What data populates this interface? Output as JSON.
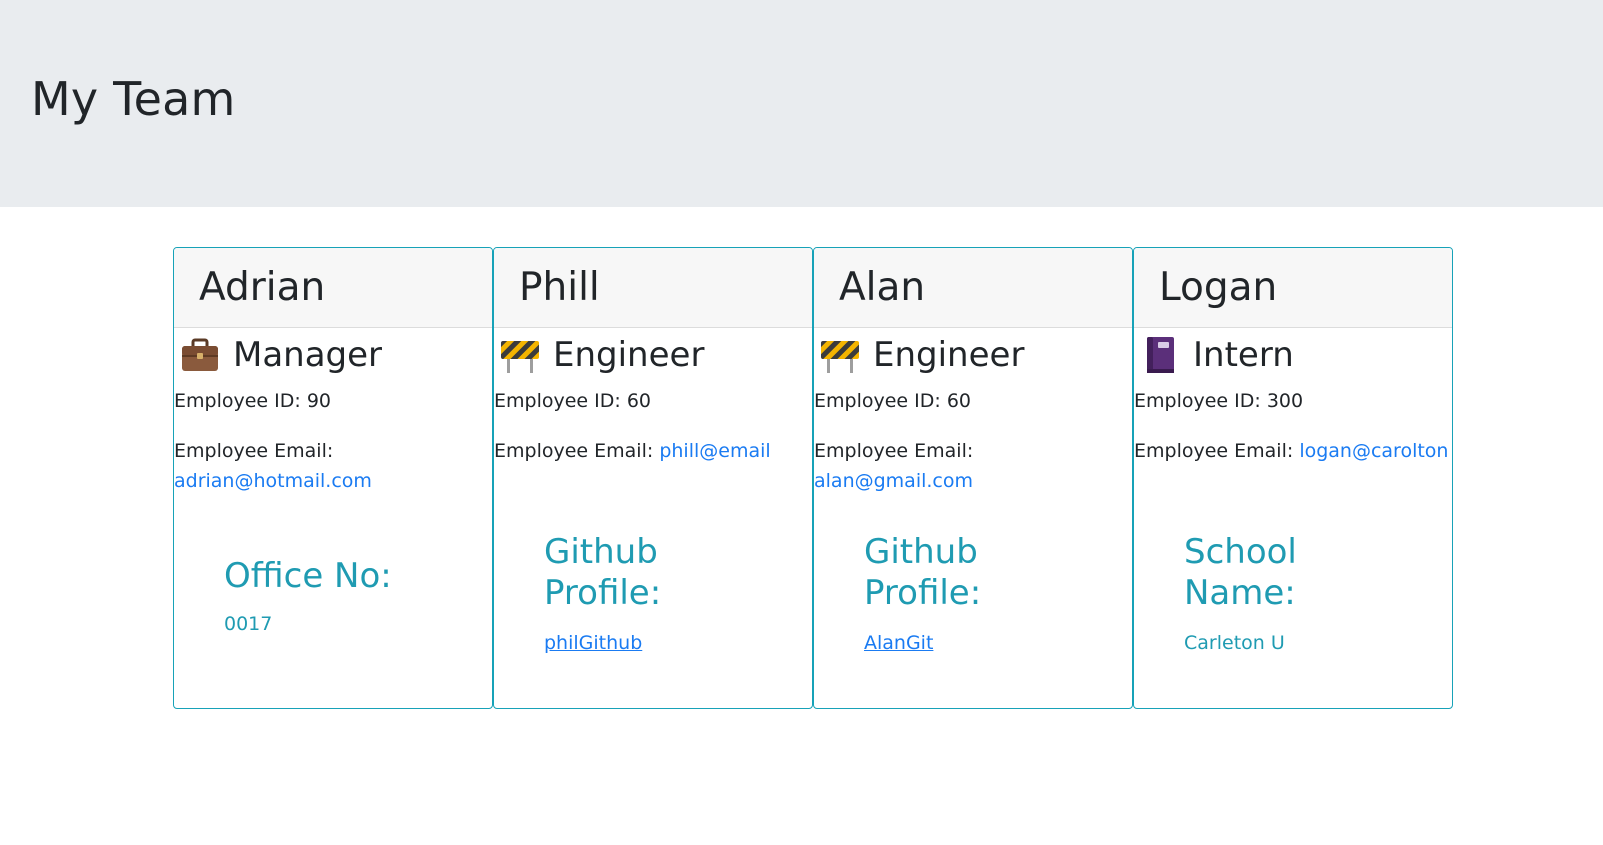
{
  "header": {
    "title": "My Team"
  },
  "employees": [
    {
      "name": "Adrian",
      "role": "Manager",
      "role_icon": "briefcase-icon",
      "id_text": "Employee ID: 90",
      "email_label": "Employee Email:",
      "email": "adrian@hotmail.com",
      "extra_label": "Office No:",
      "extra_value": "0017"
    },
    {
      "name": "Phill",
      "role": "Engineer",
      "role_icon": "construction-barrier-icon",
      "id_text": "Employee ID: 60",
      "email_label": "Employee Email:",
      "email": "phill@email",
      "extra_label": "Github Profile:",
      "extra_value": "philGithub"
    },
    {
      "name": "Alan",
      "role": "Engineer",
      "role_icon": "construction-barrier-icon",
      "id_text": "Employee ID: 60",
      "email_label": "Employee Email:",
      "email": "alan@gmail.com",
      "extra_label": "Github Profile:",
      "extra_value": "AlanGit"
    },
    {
      "name": "Logan",
      "role": "Intern",
      "role_icon": "notebook-icon",
      "id_text": "Employee ID: 300",
      "email_label": "Employee Email:",
      "email": "logan@carolton",
      "extra_label": "School Name:",
      "extra_value": "Carleton U"
    }
  ],
  "colors": {
    "header_bg": "#e9ecef",
    "card_border": "#17a2b8",
    "accent_teal": "#1f9bb2",
    "link_blue": "#1a7bf2"
  }
}
